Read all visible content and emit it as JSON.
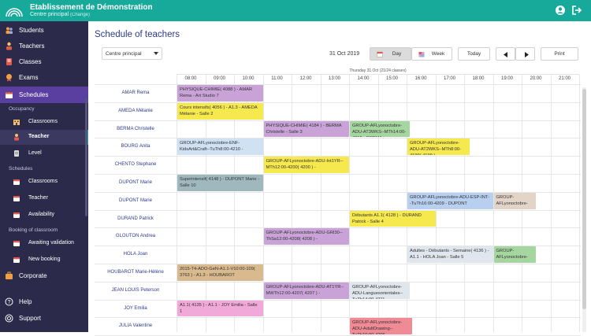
{
  "header": {
    "school_name": "Etablissement de Démonstration",
    "site": "Centre principal",
    "change_label": "(Change)",
    "user_icon": "user-circle-icon",
    "logout_icon": "logout-icon"
  },
  "sidebar": {
    "items": [
      {
        "label": "Students",
        "icon": "students-icon"
      },
      {
        "label": "Teachers",
        "icon": "teachers-icon"
      },
      {
        "label": "Classes",
        "icon": "classes-icon"
      },
      {
        "label": "Exams",
        "icon": "exams-icon"
      },
      {
        "label": "Schedules",
        "icon": "calendar-icon"
      }
    ],
    "sections": {
      "occupancy": "Occupancy",
      "schedules": "Schedules",
      "booking": "Booking of classroom"
    },
    "occupancy_items": [
      {
        "label": "Classrooms"
      },
      {
        "label": "Teacher"
      },
      {
        "label": "Level"
      }
    ],
    "schedule_items": [
      {
        "label": "Classrooms"
      },
      {
        "label": "Teacher"
      },
      {
        "label": "Availability"
      }
    ],
    "booking_items": [
      {
        "label": "Awaiting validation"
      },
      {
        "label": "New booking"
      }
    ],
    "bottom_items": [
      {
        "label": "Corporate"
      },
      {
        "label": "Help"
      },
      {
        "label": "Support"
      }
    ]
  },
  "main": {
    "title": "Schedule of teachers",
    "site_select": "Centre principal",
    "date": "31 Oct 2019",
    "buttons": {
      "day": "Day",
      "week": "Week",
      "today": "Today",
      "print": "Print"
    },
    "header_caption": "Thursday 31 Oct (21/24 classes)",
    "hours": [
      "08:00",
      "09:00",
      "10:00",
      "11:00",
      "12:00",
      "13:00",
      "14:00",
      "15:00",
      "16:00",
      "17:00",
      "18:00",
      "19:00",
      "20:00",
      "21:00"
    ],
    "teachers": [
      "AMAR Rema",
      "AMEDA Mélanie",
      "BERMA Christelle",
      "BOURG Anita",
      "CHENTO Stephane",
      "DUPONT Marie",
      "DUPONT Marie",
      "DURAND Patrick",
      "GLOUTON Andrea",
      "HOLA Joan",
      "HOUBAROT Marie-Hélène",
      "JEAN LOUIS Peterson",
      "JOY Emilia",
      "JULIA Valentine"
    ],
    "events": [
      {
        "row": 0,
        "text": "PHYSIQUE-CHIMIE( 4088 ) - AMAR Rema - Art Studio 7",
        "color": "#c9a3d8"
      },
      {
        "row": 1,
        "text": "Cours intensifs( 4056 ) - A1.3 - AMEDA Mélanie - Salle 2",
        "color": "#f6e94d"
      },
      {
        "row": 2,
        "text": "PHYSIQUE-CHIMIE( 4184 ) - BERMA Christelle - Salle 3",
        "color": "#c9a3d8"
      },
      {
        "row": 2,
        "text": "GROUP-AFLyonoctobre-ADU-AT3WKS--MTh14:00-4212 - BERMA",
        "color": "#a6d6a0"
      },
      {
        "row": 3,
        "text": "GROUP-AFLyonoctobre-ENF-KidsArt&Craft--TuTh8:00-4210 -",
        "color": "#cfe1f2"
      },
      {
        "row": 3,
        "text": "GROUP-AFLyonoctobre-ADU-AT2WKS--MTh8:00-4199( 4199 ) -",
        "color": "#f6e94d"
      },
      {
        "row": 4,
        "text": "GROUP-AFLyonoctobre-ADU-Int1YR--MTh12:00-4200( 4200 ) -",
        "color": "#f6e94d"
      },
      {
        "row": 5,
        "text": "Superintensif( 4148 ) - DUPONT Marie - Salle 10",
        "color": "#9fb8be"
      },
      {
        "row": 6,
        "text": "GROUP-AFLyonoctobre-ADU-ESP-INT--TuTh16:00-4209 - DUPONT",
        "color": "#b9cff0"
      },
      {
        "row": 6,
        "text": "GROUP-AFLyonoctobre-",
        "color": "#e2d5c8"
      },
      {
        "row": 7,
        "text": "Débutants A1.1( 4128 ) - DURAND Patrick - Salle 4",
        "color": "#f6e94d"
      },
      {
        "row": 8,
        "text": "GROUP-AFLyonoctobre-ADU-GRI30--ThSa12:00-4208( 4208 ) -",
        "color": "#c9a3d8"
      },
      {
        "row": 9,
        "text": "Adultes - Débutants - Semaine( 4136 ) - A1.1 - HOLA Joan - Salle 5",
        "color": "#dfe6ee"
      },
      {
        "row": 9,
        "text": "GROUP-AFLyonoctobre-",
        "color": "#a6d6a0"
      },
      {
        "row": 10,
        "text": "2015-T4-ADO-GeN-A1.1-V10:00-109( 3763 ) - A1.3 - HOUBAROT",
        "color": "#d9b98e"
      },
      {
        "row": 11,
        "text": "GROUP-AFLyonoctobre-ADU-AT1YR--MWTh12:00-4207( 4207 ) -",
        "color": "#c9a3d8"
      },
      {
        "row": 11,
        "text": "GROUP-AFLyonoctobre-ADU-Languesorientales--TuTh14:00-4211",
        "color": "#dfe6ee"
      },
      {
        "row": 12,
        "text": "A1.1( 4135 ) - A1.1 - JOY Emilia - Salle 1",
        "color": "#f0a9d8"
      },
      {
        "row": 13,
        "text": "GROUP-AFLyonoctobre-ADU-AdultDrawing--TuTh10:00-4206",
        "color": "#f08a95"
      }
    ]
  }
}
